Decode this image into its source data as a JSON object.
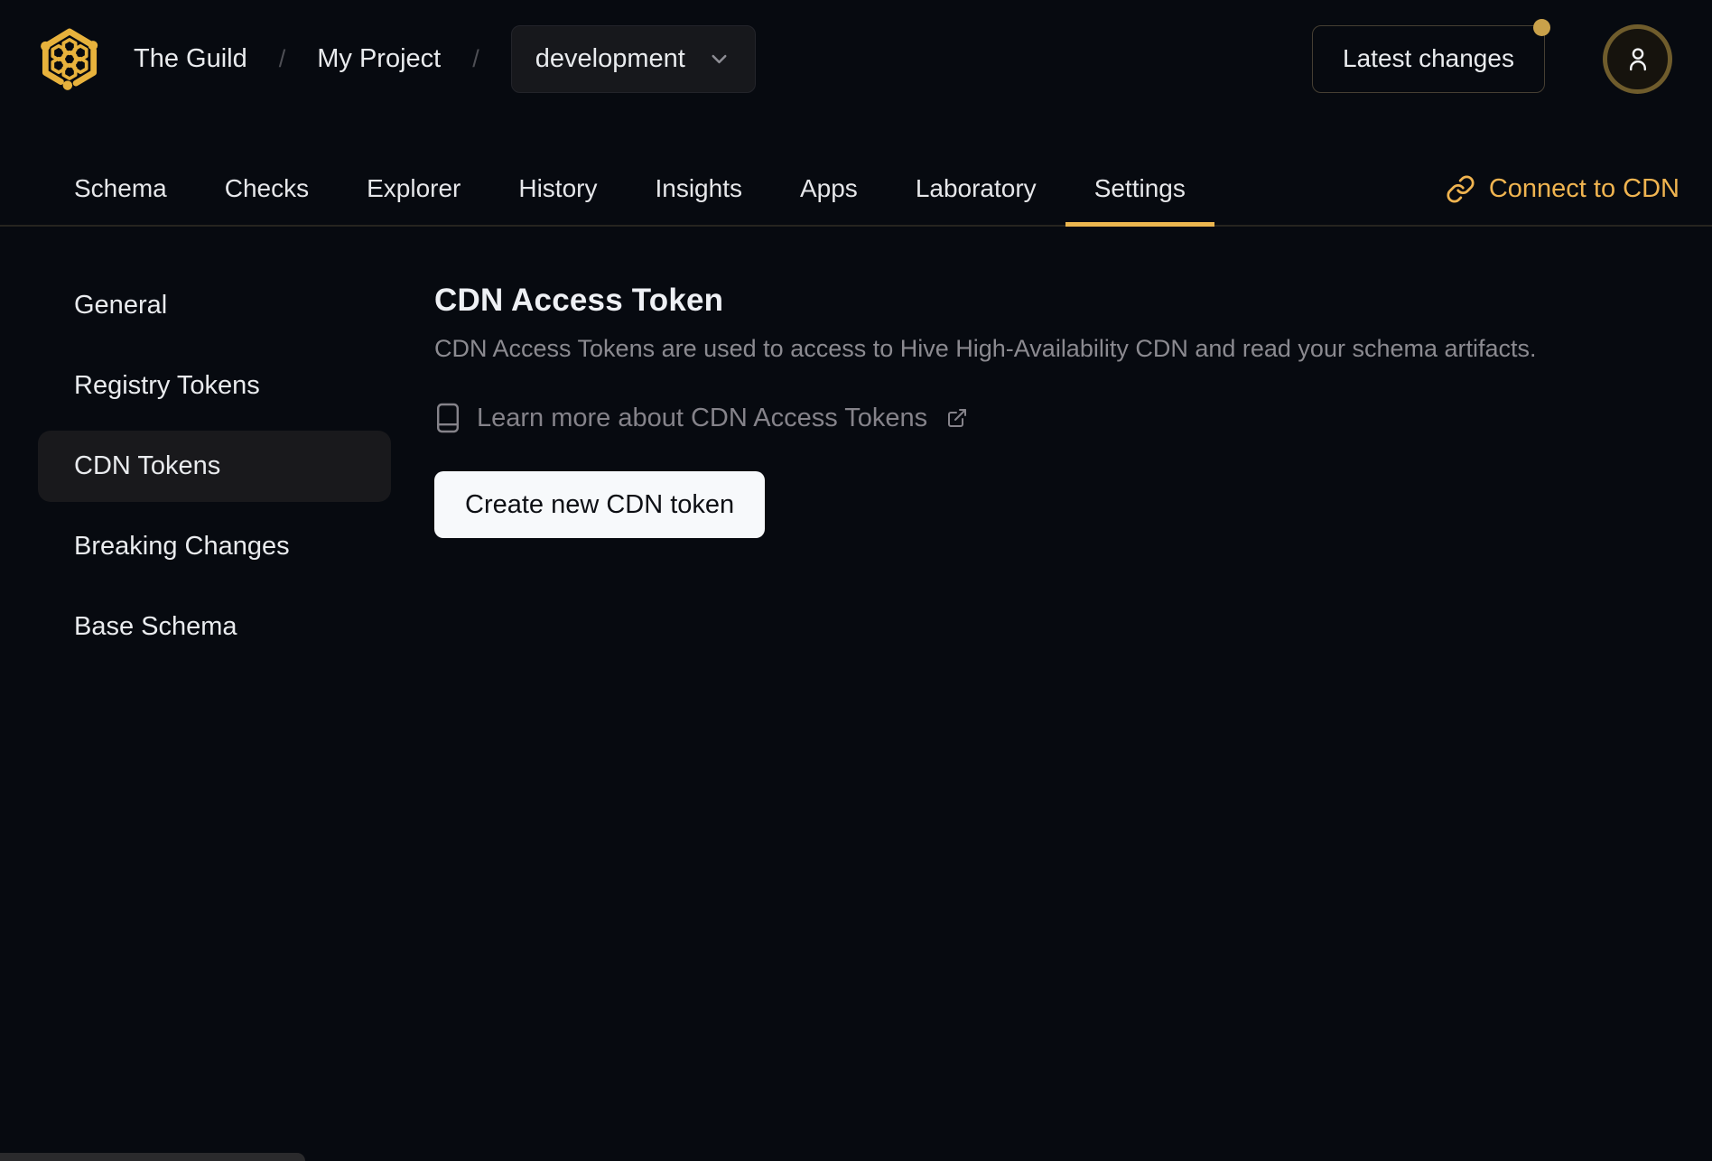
{
  "header": {
    "breadcrumb": {
      "org": "The Guild",
      "separator": "/",
      "project": "My Project"
    },
    "environment_selector": {
      "value": "development"
    },
    "latest_changes_label": "Latest changes"
  },
  "tabs": {
    "items": [
      {
        "label": "Schema"
      },
      {
        "label": "Checks"
      },
      {
        "label": "Explorer"
      },
      {
        "label": "History"
      },
      {
        "label": "Insights"
      },
      {
        "label": "Apps"
      },
      {
        "label": "Laboratory"
      },
      {
        "label": "Settings"
      }
    ],
    "active_tab": "Settings",
    "connect_cdn_label": "Connect to CDN"
  },
  "sidebar": {
    "items": [
      {
        "label": "General"
      },
      {
        "label": "Registry Tokens"
      },
      {
        "label": "CDN Tokens",
        "active": true
      },
      {
        "label": "Breaking Changes"
      },
      {
        "label": "Base Schema"
      }
    ]
  },
  "main": {
    "title": "CDN Access Token",
    "description": "CDN Access Tokens are used to access to Hive High-Availability CDN and read your schema artifacts.",
    "learn_more_label": "Learn more about CDN Access Tokens",
    "create_button_label": "Create new CDN token"
  },
  "colors": {
    "page_background": "#070a10",
    "accent_gold": "#f0b450",
    "logo_gold": "#e8b23c",
    "active_tab_underline": "#ecb64f",
    "notification_dot": "#c9a14a",
    "avatar_ring": "#6f5c2c",
    "sidebar_active_background": "#19191c",
    "primary_button_background": "#f7f9fb",
    "muted_text": "#8b8a90"
  },
  "icons": {
    "logo": "hive-honeycomb-logo",
    "dropdown": "chevron-down",
    "avatar": "user-silhouette",
    "connect": "chain-link",
    "learn_more_left": "book",
    "learn_more_right": "external-link"
  }
}
